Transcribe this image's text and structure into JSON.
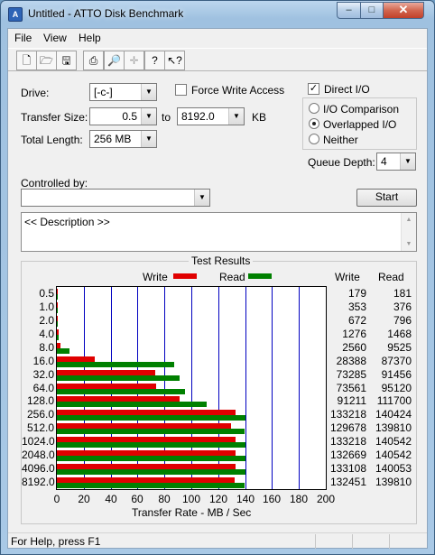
{
  "window": {
    "title": "Untitled - ATTO Disk Benchmark"
  },
  "menu": [
    "File",
    "View",
    "Help"
  ],
  "toolbar": [
    "new-icon",
    "open-icon",
    "save-icon",
    "print-icon",
    "print-preview-icon",
    "move-icon",
    "help-icon",
    "context-help-icon"
  ],
  "settings": {
    "drive_label": "Drive:",
    "drive_value": "[-c-]",
    "force_write_label": "Force Write Access",
    "force_write_checked": false,
    "direct_io_label": "Direct I/O",
    "direct_io_checked": true,
    "transfer_label": "Transfer Size:",
    "transfer_from": "0.5",
    "to_label": "to",
    "transfer_to": "8192.0",
    "kb_label": "KB",
    "total_length_label": "Total Length:",
    "total_length_value": "256 MB",
    "io_comparison": "I/O Comparison",
    "overlapped_io": "Overlapped I/O",
    "neither": "Neither",
    "selected_mode": "Overlapped I/O",
    "queue_depth_label": "Queue Depth:",
    "queue_depth_value": "4",
    "controlled_by_label": "Controlled by:",
    "controlled_by_value": "",
    "start_label": "Start",
    "description_value": "<< Description >>"
  },
  "results": {
    "title": "Test Results",
    "write_legend": "Write",
    "read_legend": "Read",
    "write_col": "Write",
    "read_col": "Read",
    "colors": {
      "write": "#e00000",
      "read": "#008000",
      "grid": "#0000c0"
    }
  },
  "chart_data": {
    "type": "bar",
    "orientation": "horizontal",
    "xlabel": "Transfer Rate - MB / Sec",
    "xlim": [
      0,
      200
    ],
    "xticks": [
      0,
      20,
      40,
      60,
      80,
      100,
      120,
      140,
      160,
      180,
      200
    ],
    "categories": [
      "0.5",
      "1.0",
      "2.0",
      "4.0",
      "8.0",
      "16.0",
      "32.0",
      "64.0",
      "128.0",
      "256.0",
      "512.0",
      "1024.0",
      "2048.0",
      "4096.0",
      "8192.0"
    ],
    "series": [
      {
        "name": "Write",
        "values": [
          179,
          353,
          672,
          1276,
          2560,
          28388,
          73285,
          73561,
          91211,
          133218,
          129678,
          133218,
          132669,
          133108,
          132451
        ]
      },
      {
        "name": "Read",
        "values": [
          181,
          376,
          796,
          1468,
          9525,
          87370,
          91456,
          95120,
          111700,
          140424,
          139810,
          140542,
          140542,
          140053,
          139810
        ]
      }
    ],
    "legend": "top",
    "grid": true
  },
  "status": {
    "text": "For Help, press F1"
  }
}
